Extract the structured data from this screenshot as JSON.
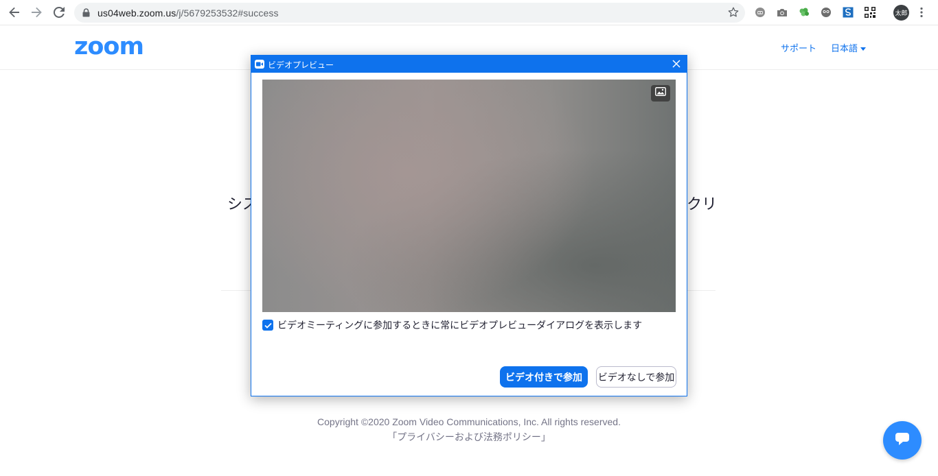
{
  "browser": {
    "url_host": "us04web.zoom.us",
    "url_path": "/j/5679253532#success",
    "profile_label": "太郎"
  },
  "header": {
    "logo": "zoom",
    "support": "サポート",
    "language": "日本語"
  },
  "background": {
    "text_left": "シス",
    "text_right": "クリ",
    "copyright": "Copyright ©2020 Zoom Video Communications, Inc. All rights reserved.",
    "privacy": "「プライバシーおよび法務ポリシー」"
  },
  "dialog": {
    "title": "ビデオプレビュー",
    "checkbox_label": "ビデオミーティングに参加するときに常にビデオプレビューダイアログを表示します",
    "checkbox_checked": true,
    "join_with_video": "ビデオ付きで参加",
    "join_without_video": "ビデオなしで参加"
  },
  "colors": {
    "accent": "#0e72ed",
    "logo": "#2d8cff"
  }
}
